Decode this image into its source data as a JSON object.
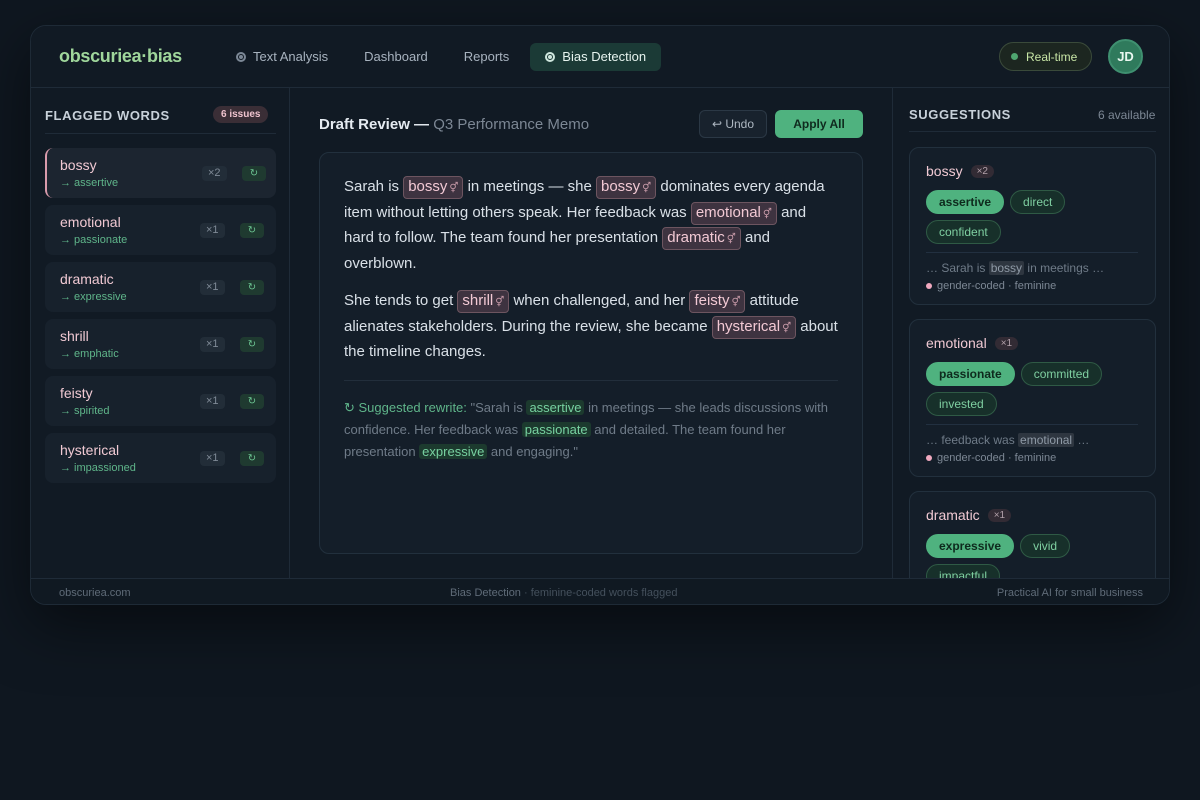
{
  "app": {
    "logo": "obscuriea·bias",
    "nav": [
      {
        "label": "Text Analysis",
        "icon": "radio-dot-icon"
      },
      {
        "label": "Dashboard"
      },
      {
        "label": "Reports"
      },
      {
        "label": "Bias Detection",
        "icon": "radio-dot-icon",
        "active": true
      }
    ],
    "realtime_label": "Real-time",
    "avatar_initials": "JD"
  },
  "left": {
    "title": "FLAGGED WORDS",
    "issues_badge": "6 issues",
    "items": [
      {
        "word": "bossy",
        "suggestion": "→ assertive",
        "count": "×2",
        "refresh": "↻"
      },
      {
        "word": "emotional",
        "suggestion": "→ passionate",
        "count": "×1",
        "refresh": "↻"
      },
      {
        "word": "dramatic",
        "suggestion": "→ expressive",
        "count": "×1",
        "refresh": "↻"
      },
      {
        "word": "shrill",
        "suggestion": "→ emphatic",
        "count": "×1",
        "refresh": "↻"
      },
      {
        "word": "feisty",
        "suggestion": "→ spirited",
        "count": "×1",
        "refresh": "↻"
      },
      {
        "word": "hysterical",
        "suggestion": "→ impassioned",
        "count": "×1",
        "refresh": "↻"
      }
    ]
  },
  "center": {
    "title_bold": "Draft Review —",
    "title_sub": "Q3 Performance Memo",
    "undo_label": "↩ Undo",
    "apply_label": "Apply All",
    "gender_icon": "⚥",
    "p1": {
      "t1": "Sarah is ",
      "h1": "bossy",
      "t2": " in meetings — she ",
      "h2": "bossy",
      "t3": " dominates every agenda item without letting others speak. Her feedback was ",
      "h3": "emotional",
      "t4": " and hard to follow. The team found her presentation ",
      "h4": "dramatic",
      "t5": " and overblown."
    },
    "p2": {
      "t1": "She tends to get ",
      "h1": "shrill",
      "t2": " when challenged, and her ",
      "h2": "feisty",
      "t3": " attitude alienates stakeholders. During the review, she became ",
      "h3": "hysterical",
      "t4": " about the timeline changes."
    },
    "rewrite": {
      "label": "↻ Suggested rewrite:",
      "t1": " \"Sarah is ",
      "h1": "assertive",
      "t2": " in meetings — she leads discussions with confidence. Her feedback was ",
      "h2": "passionate",
      "t3": " and detailed. The team found her presentation ",
      "h3": "expressive",
      "t4": " and engaging.\""
    }
  },
  "right": {
    "title": "SUGGESTIONS",
    "available": "6 available",
    "cards": [
      {
        "word": "bossy",
        "count": "×2",
        "chips": [
          "assertive",
          "direct",
          "confident"
        ],
        "context_pre": "… Sarah is ",
        "context_hl": "bossy",
        "context_post": " in meetings …",
        "tag": "gender-coded · feminine"
      },
      {
        "word": "emotional",
        "count": "×1",
        "chips": [
          "passionate",
          "committed",
          "invested"
        ],
        "context_pre": "… feedback was ",
        "context_hl": "emotional",
        "context_post": " …",
        "tag": "gender-coded · feminine"
      },
      {
        "word": "dramatic",
        "count": "×1",
        "chips": [
          "expressive",
          "vivid",
          "impactful"
        ]
      }
    ]
  },
  "footer": {
    "left": "obscuriea.com",
    "center_main": "Bias Detection",
    "center_muted": " · feminine-coded words flagged",
    "right": "Practical AI for small business"
  },
  "colors": {
    "accent_green": "#4fb27f",
    "flag_pink": "#f0c9d3",
    "background": "#0f1720"
  }
}
